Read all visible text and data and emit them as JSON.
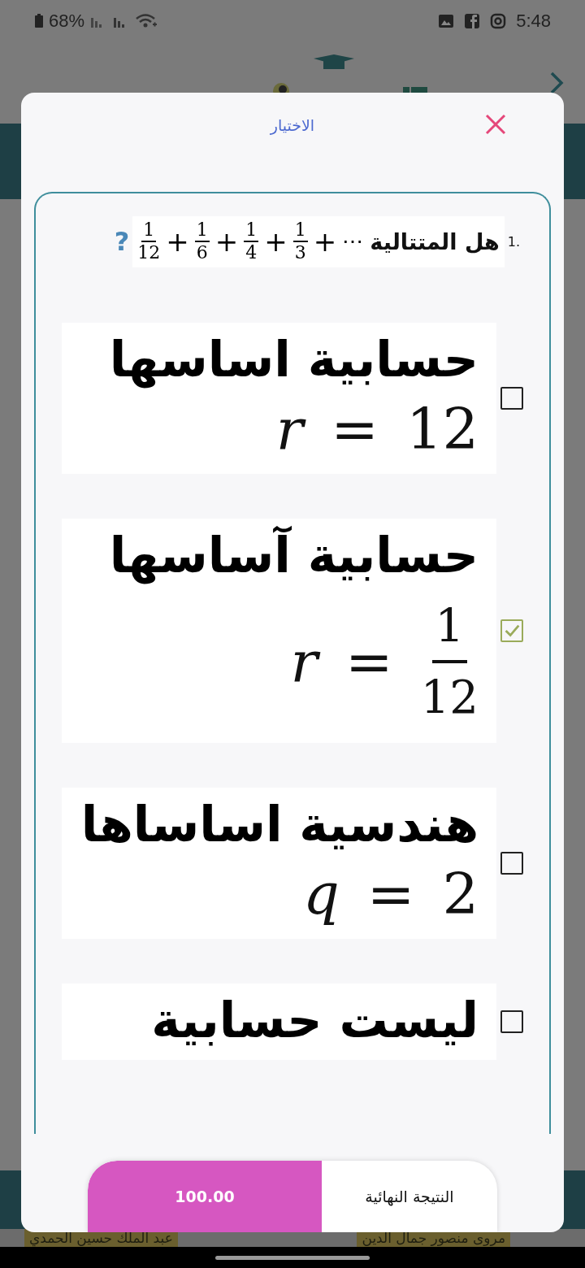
{
  "status_bar": {
    "battery": "68%",
    "time": "5:48"
  },
  "background": {
    "names": [
      "مروى منصور جمال الدين",
      "عبد الملك حسين الحمدي"
    ]
  },
  "dialog": {
    "title": "الاختيار",
    "question": {
      "number": "1.",
      "text": "هل المتتالية",
      "operator": "+",
      "ellipsis": "⋯",
      "mark": "?",
      "terms": [
        {
          "numerator": "1",
          "denominator": "3"
        },
        {
          "numerator": "1",
          "denominator": "4"
        },
        {
          "numerator": "1",
          "denominator": "6"
        },
        {
          "numerator": "1",
          "denominator": "12"
        }
      ]
    },
    "options": [
      {
        "kind": "plain",
        "text": "حسابية اساسها",
        "variable": "r",
        "relation": "=",
        "value": "12",
        "checked": false
      },
      {
        "kind": "fraction",
        "text": "حسابية آساسها",
        "variable": "r",
        "relation": "=",
        "numerator": "1",
        "denominator": "12",
        "checked": true
      },
      {
        "kind": "plain",
        "text": "هندسية اساساها",
        "variable": "q",
        "relation": "=",
        "value": "2",
        "checked": false
      },
      {
        "kind": "text",
        "text": "ليست حسابية",
        "checked": false
      }
    ],
    "result": {
      "label": "النتيجة النهائية",
      "score": "100.00"
    }
  }
}
